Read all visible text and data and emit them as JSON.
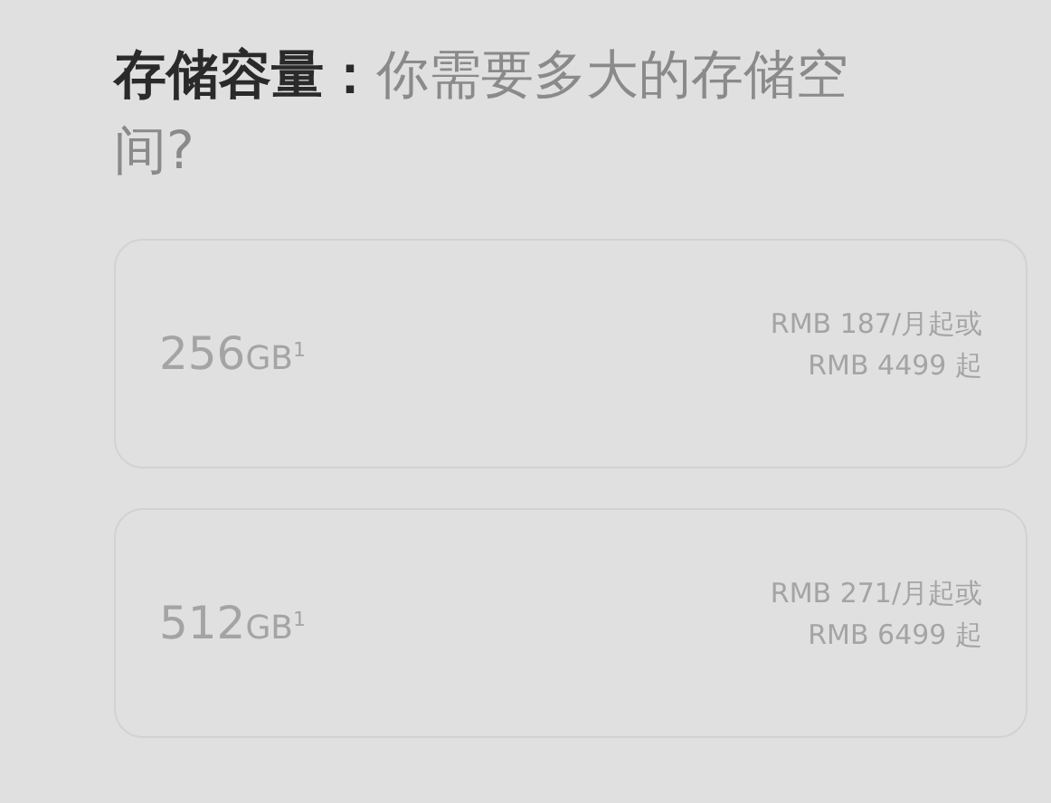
{
  "heading": "**存储容量：**你需要多大的存储空间?",
  "options": [
    {
      "capacity": "256",
      "unit": "GB$^{1}$",
      "price_monthly": "RMB 187/月起或",
      "price_full": "RMB 4499 起",
      "disabled": true
    },
    {
      "capacity": "512",
      "unit": "GB$^{1}$",
      "price_monthly": "RMB 271/月起或",
      "price_full": "RMB 6499 起",
      "disabled": true
    }
  ]
}
